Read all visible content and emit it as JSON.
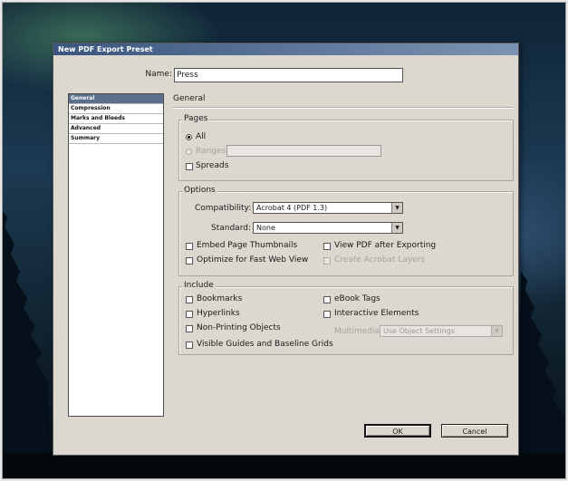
{
  "dialog": {
    "title": "New PDF Export Preset",
    "name_label": "Name:",
    "name_value": "Press"
  },
  "sidebar": {
    "items": [
      {
        "label": "General",
        "selected": true
      },
      {
        "label": "Compression",
        "selected": false
      },
      {
        "label": "Marks and Bleeds",
        "selected": false
      },
      {
        "label": "Advanced",
        "selected": false
      },
      {
        "label": "Summary",
        "selected": false
      }
    ]
  },
  "panel": {
    "section_title": "General",
    "pages": {
      "label": "Pages",
      "all_label": "All",
      "all_selected": true,
      "ranges_label": "Ranges:",
      "ranges_value": "",
      "spreads_label": "Spreads",
      "spreads_checked": false
    },
    "options": {
      "label": "Options",
      "compatibility_label": "Compatibility:",
      "compatibility_value": "Acrobat 4 (PDF 1.3)",
      "standard_label": "Standard:",
      "standard_value": "None",
      "embed_thumbnails_label": "Embed Page Thumbnails",
      "optimize_web_label": "Optimize for Fast Web View",
      "view_after_export_label": "View PDF after Exporting",
      "create_layers_label": "Create Acrobat Layers"
    },
    "include": {
      "label": "Include",
      "bookmarks_label": "Bookmarks",
      "hyperlinks_label": "Hyperlinks",
      "non_printing_label": "Non-Printing Objects",
      "guides_grids_label": "Visible Guides and Baseline Grids",
      "ebook_tags_label": "eBook Tags",
      "interactive_label": "Interactive Elements",
      "multimedia_label": "Multimedia:",
      "multimedia_value": "Use Object Settings"
    }
  },
  "buttons": {
    "ok_label": "OK",
    "cancel_label": "Cancel"
  },
  "colors": {
    "dialog_bg": "#dcd7cf",
    "titlebar_start": "#3a567e",
    "titlebar_end": "#7d93b3",
    "sidebar_selected": "#5b6f8d"
  }
}
